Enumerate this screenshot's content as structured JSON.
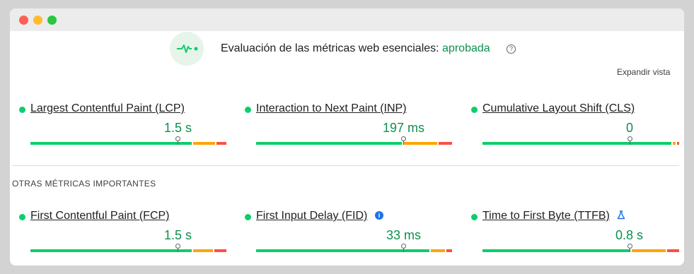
{
  "window": {
    "controls": [
      "close",
      "minimize",
      "zoom"
    ]
  },
  "assessment": {
    "icon": "pulse-icon",
    "text": "Evaluación de las métricas web esenciales: ",
    "status": "aprobada",
    "help_icon": "?"
  },
  "expand_label": "Expandir vista",
  "section_title": "OTRAS MÉTRICAS IMPORTANTES",
  "core_metrics": [
    {
      "label": "Largest Contentful Paint (LCP)",
      "value": "1.5 s",
      "rating": "good"
    },
    {
      "label": "Interaction to Next Paint (INP)",
      "value": "197 ms",
      "rating": "good"
    },
    {
      "label": "Cumulative Layout Shift (CLS)",
      "value": "0",
      "rating": "good"
    }
  ],
  "other_metrics": [
    {
      "label": "First Contentful Paint (FCP)",
      "value": "1.5 s",
      "rating": "good"
    },
    {
      "label": "First Input Delay (FID)",
      "value": "33 ms",
      "rating": "good",
      "badge": "info-icon",
      "badge_text": "i"
    },
    {
      "label": "Time to First Byte (TTFB)",
      "value": "0.8 s",
      "rating": "good",
      "badge": "flask-icon"
    }
  ],
  "distribution": {
    "lcp": {
      "good": 0.83,
      "needs_improvement": 0.12,
      "poor": 0.05,
      "p75": 0.75
    },
    "inp": {
      "good": 0.75,
      "needs_improvement": 0.18,
      "poor": 0.07,
      "p75": 0.75
    },
    "cls": {
      "good": 0.97,
      "needs_improvement": 0.02,
      "poor": 0.01,
      "p75": 0.75
    },
    "fcp": {
      "good": 0.83,
      "needs_improvement": 0.11,
      "poor": 0.06,
      "p75": 0.75
    },
    "fid": {
      "good": 0.89,
      "needs_improvement": 0.08,
      "poor": 0.03,
      "p75": 0.75
    },
    "ttfb": {
      "good": 0.76,
      "needs_improvement": 0.18,
      "poor": 0.06,
      "p75": 0.75
    }
  },
  "colors": {
    "good": "#0cce6b",
    "needs_improvement": "#ffa400",
    "poor": "#ff4e42",
    "pass_text": "#0d904f"
  }
}
